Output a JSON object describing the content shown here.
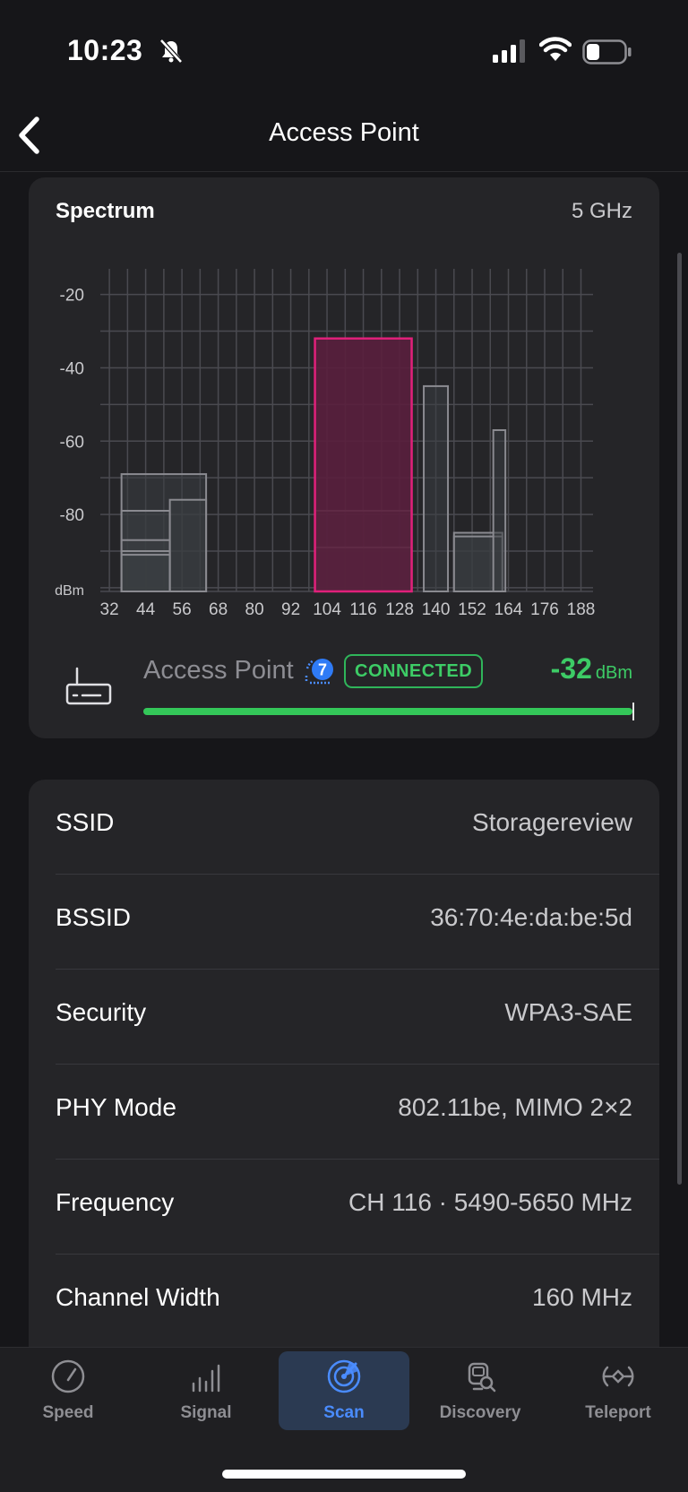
{
  "status_bar": {
    "time": "10:23",
    "icons": [
      "bell-slash-icon",
      "cellular-signal-icon",
      "wifi-icon",
      "battery-icon"
    ]
  },
  "nav": {
    "title": "Access Point",
    "back_icon": "chevron-left-icon"
  },
  "spectrum": {
    "title": "Spectrum",
    "band": "5 GHz",
    "chart_data": {
      "type": "bar",
      "ylabel": "dBm",
      "yticks": [
        -20,
        -40,
        -60,
        -80
      ],
      "ylim": [
        -101,
        -13
      ],
      "xticks": [
        32,
        44,
        56,
        68,
        80,
        92,
        104,
        116,
        128,
        140,
        152,
        164,
        176,
        188
      ],
      "xlim": [
        29,
        192
      ],
      "grid": true,
      "networks": [
        {
          "from": 36,
          "to": 64,
          "dbm": -69,
          "highlight": false
        },
        {
          "from": 36,
          "to": 52,
          "dbm": -79,
          "highlight": false
        },
        {
          "from": 36,
          "to": 52,
          "dbm": -87,
          "highlight": false
        },
        {
          "from": 36,
          "to": 52,
          "dbm": -90,
          "highlight": false
        },
        {
          "from": 36,
          "to": 52,
          "dbm": -91,
          "highlight": false
        },
        {
          "from": 52,
          "to": 64,
          "dbm": -76,
          "highlight": false
        },
        {
          "from": 100,
          "to": 132,
          "dbm": -32,
          "highlight": true
        },
        {
          "from": 100,
          "to": 132,
          "dbm": -79,
          "highlight": false
        },
        {
          "from": 100,
          "to": 132,
          "dbm": -89,
          "highlight": false
        },
        {
          "from": 136,
          "to": 144,
          "dbm": -45,
          "highlight": false
        },
        {
          "from": 146,
          "to": 162,
          "dbm": -85,
          "highlight": false
        },
        {
          "from": 146,
          "to": 162,
          "dbm": -86,
          "highlight": false
        },
        {
          "from": 159,
          "to": 163,
          "dbm": -57,
          "highlight": false
        }
      ],
      "colors": {
        "grid": "#4a4a50",
        "tick": "#c9c9cc",
        "bar_stroke": "#8a8a90",
        "bar_fill": "#3a3e42",
        "highlight_stroke": "#e0207a",
        "highlight_fill": "#5a1f3d"
      }
    },
    "access_point": {
      "name": "Access Point",
      "badge": "CONNECTED",
      "rssi_value": "-32",
      "rssi_unit": "dBm",
      "signal_fraction": 1.0,
      "wifi_generation_icon": "wifi7-icon",
      "router_icon": "router-icon"
    }
  },
  "details": [
    {
      "label": "SSID",
      "value": "Storagereview"
    },
    {
      "label": "BSSID",
      "value": "36:70:4e:da:be:5d"
    },
    {
      "label": "Security",
      "value": "WPA3-SAE"
    },
    {
      "label": "PHY Mode",
      "value": "802.11be, MIMO 2×2"
    },
    {
      "label": "Frequency",
      "value": "CH 116 · 5490-5650 MHz"
    },
    {
      "label": "Channel Width",
      "value": "160 MHz"
    }
  ],
  "tabs": [
    {
      "label": "Speed",
      "icon": "speedometer-icon",
      "active": false
    },
    {
      "label": "Signal",
      "icon": "signal-bars-icon",
      "active": false
    },
    {
      "label": "Scan",
      "icon": "radar-icon",
      "active": true
    },
    {
      "label": "Discovery",
      "icon": "discovery-icon",
      "active": false
    },
    {
      "label": "Teleport",
      "icon": "teleport-icon",
      "active": false
    }
  ],
  "colors": {
    "background": "#161619",
    "card": "#252528",
    "accent_green": "#3dcc66",
    "accent_blue": "#4a8cff"
  }
}
